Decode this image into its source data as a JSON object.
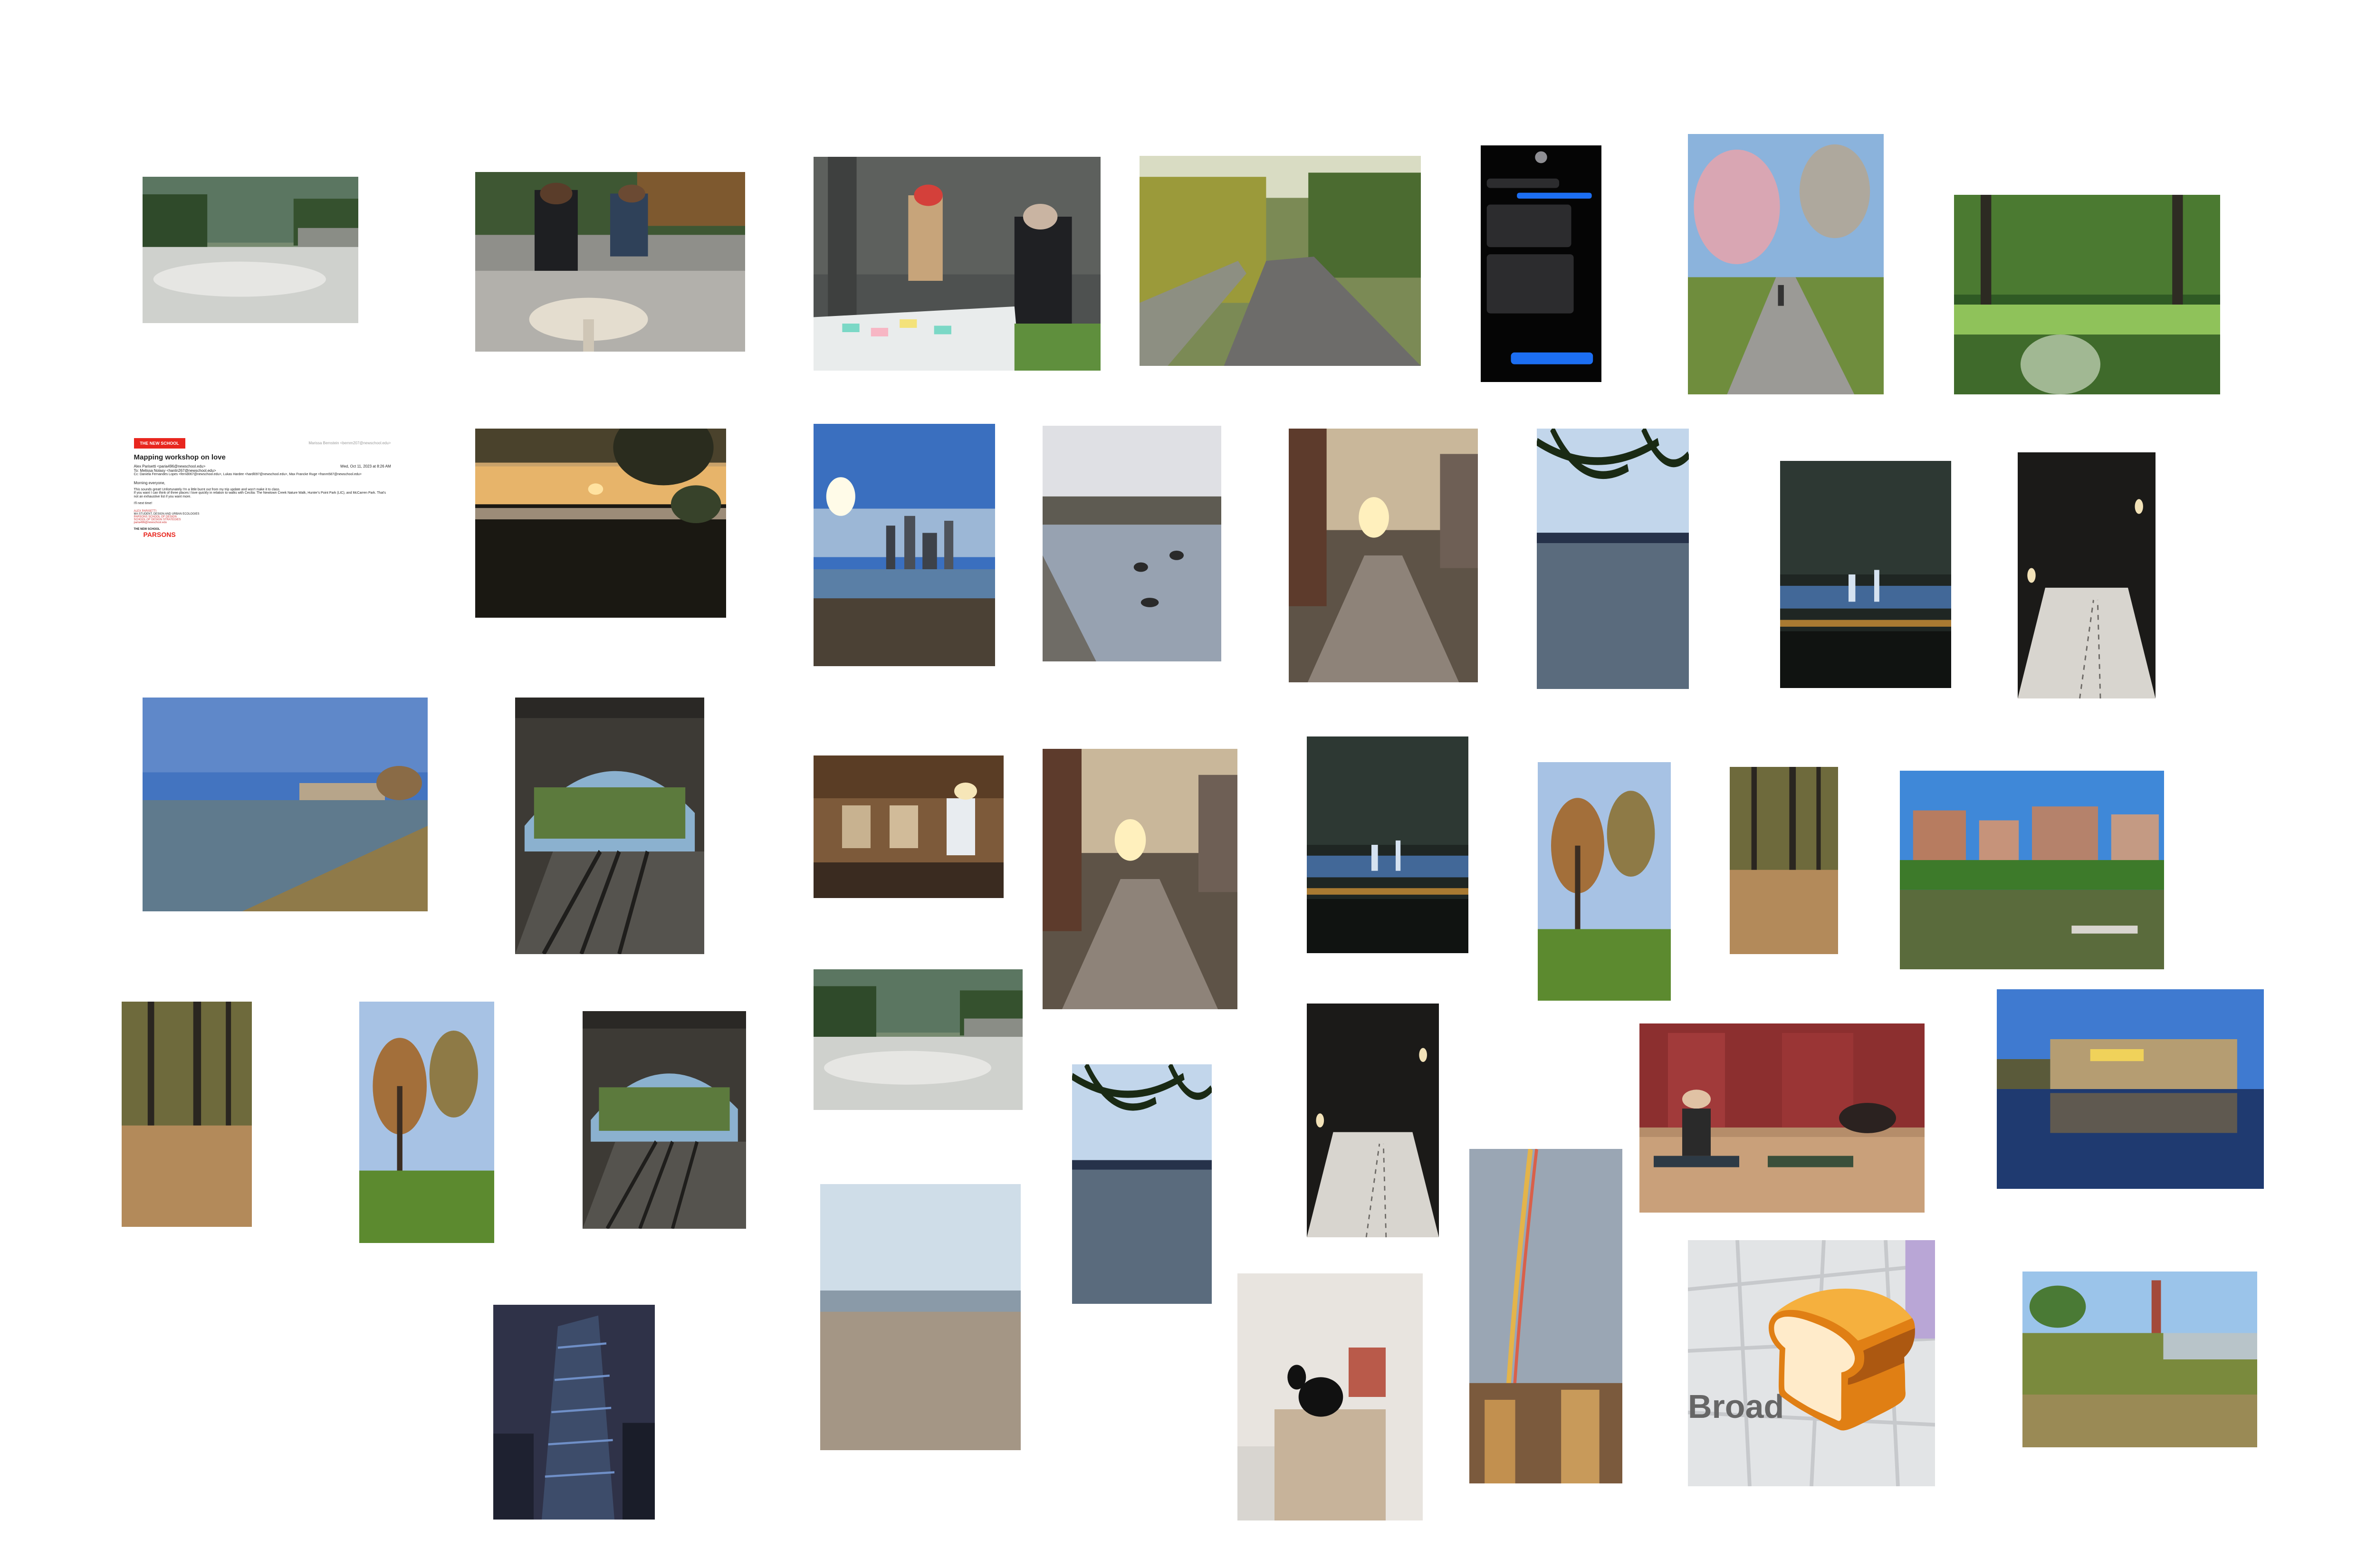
{
  "canvas": {
    "background": "#ffffff"
  },
  "email": {
    "logo_text": "THE NEW SCHOOL",
    "from_hint": "Marissa Bernstein <bernm207@newschool.edu>",
    "subject": "Mapping workshop on love",
    "date": "Wed, Oct 11, 2023 at 8:26 AM",
    "from_line": "Alex Parisetti <paria496@newschool.edu>",
    "to_line": "To: Melissa Nolasy <hantn267@newschool.edu>",
    "cc_line": "Cc: Daniela Fernandes Lopes <fernd067@newschool.edu>, Lukas Hardee <hardl097@newschool.edu>, Max Francke Ruge <franm587@newschool.edu>",
    "greeting": "Morning everyone,",
    "body1": "This sounds great! Unfortunately I'm a little burnt out from my trip update and won't make it to class.",
    "body2": "If you want I can think of three places I love quickly in relation to walks with Cecilia: The Newtown Creek Nature Walk, Hunter's Point Park (LIC), and McCarren Park. That's not an exhaustive list if you want more.",
    "signoff": "I'll next time!",
    "sig_name": "ALEX PARISETTI",
    "sig_line1": "MA STUDENT, DESIGN AND URBAN ECOLOGIES",
    "sig_line2": "PARSONS SCHOOL OF DESIGN",
    "sig_line3": "SCHOOL OF DESIGN STRATEGIES",
    "sig_email": "paria496@newschool.edu",
    "footer_brand_small": "THE NEW SCHOOL",
    "footer_brand": "PARSONS"
  },
  "map_tile": {
    "street_label": "Broad",
    "emoji": "🍞"
  },
  "photos": [
    "park-fountain-plaza",
    "students-drawing-table",
    "mapping-workshop-outdoor",
    "autumn-park-path",
    "phone-text-messages",
    "cherry-blossom-path",
    "green-park-lawn",
    "sunset-over-river",
    "brooklyn-bridge-skyline",
    "geese-on-shore",
    "sunlit-street",
    "river-water-branches",
    "night-city-skyline",
    "snowy-night-path",
    "river-shoreline",
    "subway-platform",
    "library-reading-room",
    "sunlit-street-2",
    "night-skyline-2",
    "autumn-tree-lawn",
    "fallen-leaves-forest",
    "apartments-by-pond",
    "leaves-forest-floor",
    "autumn-trees-lawn",
    "subway-platform-2",
    "park-fountain-2",
    "river-branches-2",
    "snowy-path-2",
    "yoga-class",
    "warehouse-reflection",
    "beach-sand",
    "tower-night",
    "black-cat-room",
    "rainbow-over-city",
    "marsh-wetland"
  ]
}
